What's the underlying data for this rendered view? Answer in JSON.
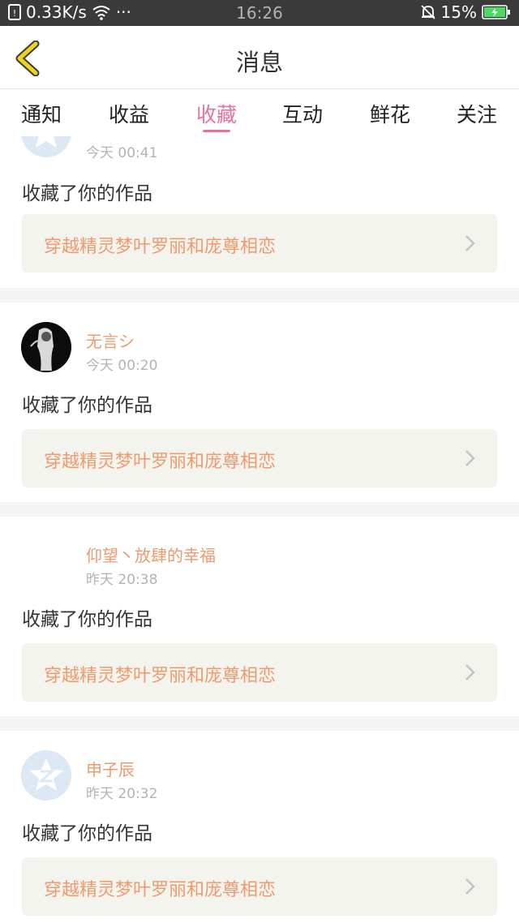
{
  "status_bar": {
    "network_speed": "0.33K/s",
    "more": "···",
    "time": "16:26",
    "battery": "15%"
  },
  "header": {
    "title": "消息"
  },
  "tabs": [
    {
      "label": "通知"
    },
    {
      "label": "收益"
    },
    {
      "label": "收藏",
      "active": true
    },
    {
      "label": "互动"
    },
    {
      "label": "鲜花"
    },
    {
      "label": "关注"
    }
  ],
  "messages": [
    {
      "username": "",
      "time": "今天 00:41",
      "action": "收藏了你的作品",
      "work_title": "穿越精灵梦叶罗丽和庞尊相恋",
      "avatar": "default-star"
    },
    {
      "username": "无言シ",
      "time": "今天 00:20",
      "action": "收藏了你的作品",
      "work_title": "穿越精灵梦叶罗丽和庞尊相恋",
      "avatar": "dark-figure"
    },
    {
      "username": "仰望丶放肆的幸福",
      "time": "昨天 20:38",
      "action": "收藏了你的作品",
      "work_title": "穿越精灵梦叶罗丽和庞尊相恋",
      "avatar": "none"
    },
    {
      "username": "申子辰",
      "time": "昨天 20:32",
      "action": "收藏了你的作品",
      "work_title": "穿越精灵梦叶罗丽和庞尊相恋",
      "avatar": "default-star"
    }
  ],
  "colors": {
    "accent_pink": "#e5729f",
    "username_orange": "#ee9a6e",
    "back_arrow_yellow": "#f2d21b"
  }
}
